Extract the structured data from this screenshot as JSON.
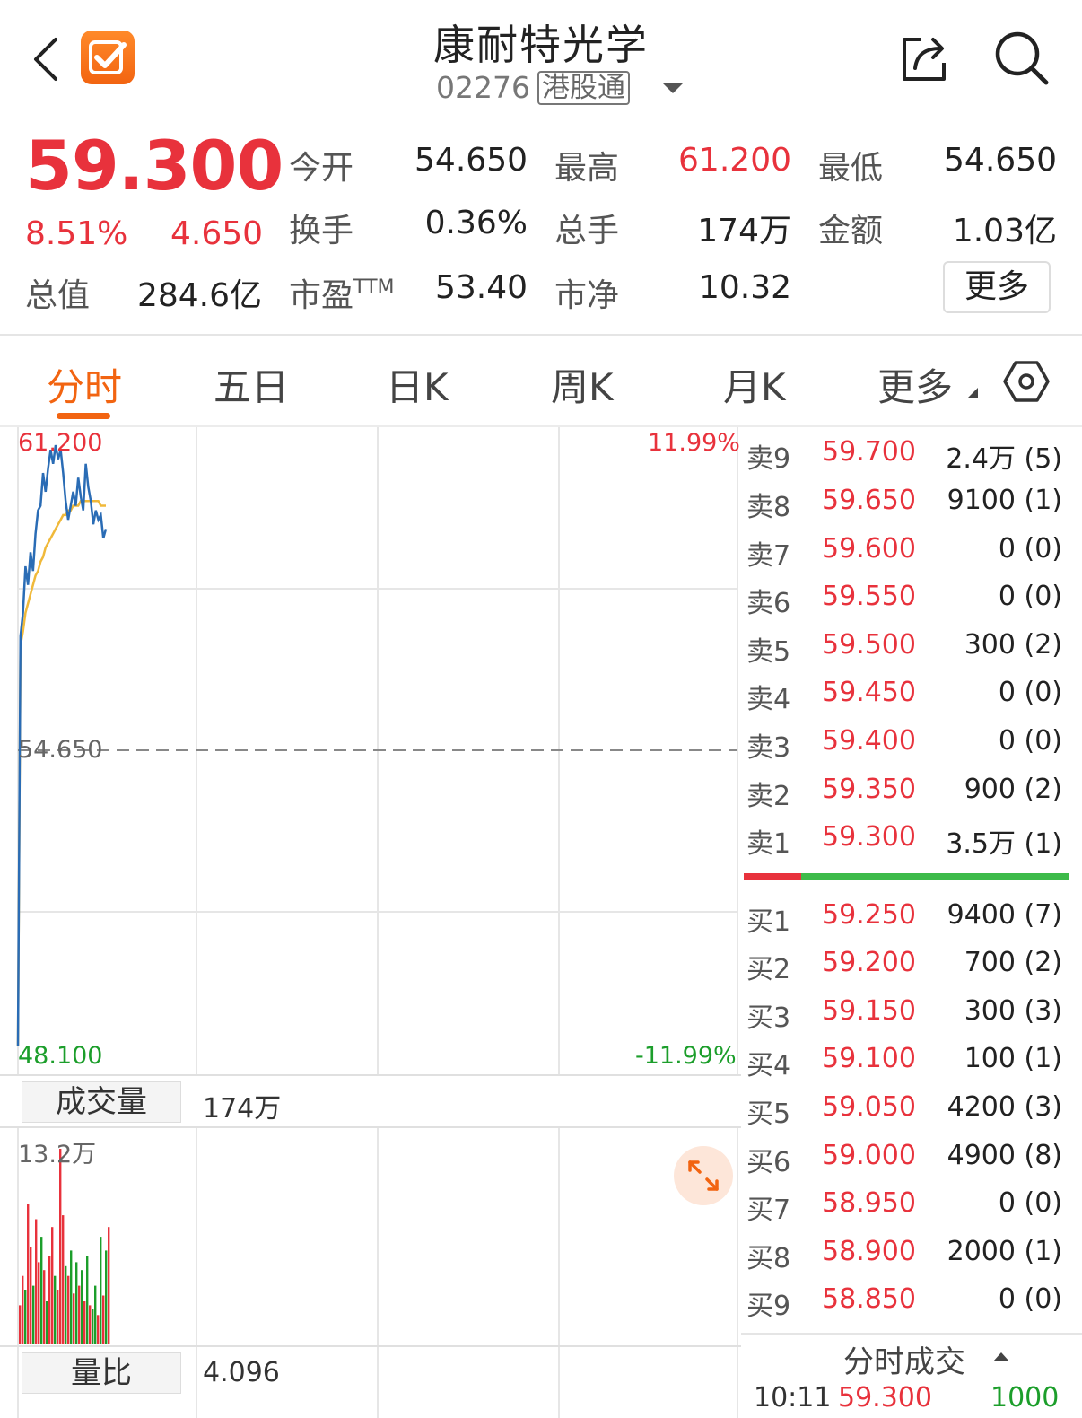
{
  "header": {
    "title": "康耐特光学",
    "code": "02276",
    "market": "港股通"
  },
  "quote": {
    "price": "59.300",
    "change_pct": "8.51%",
    "change_amt": "4.650",
    "stats": [
      {
        "label": "今开",
        "value": "54.650",
        "color": "normal"
      },
      {
        "label": "最高",
        "value": "61.200",
        "color": "red"
      },
      {
        "label": "最低",
        "value": "54.650",
        "color": "normal"
      },
      {
        "label": "换手",
        "value": "0.36%",
        "color": "normal"
      },
      {
        "label": "总手",
        "value": "174万",
        "color": "normal"
      },
      {
        "label": "金额",
        "value": "1.03亿",
        "color": "normal"
      },
      {
        "label": "总值",
        "value": "284.6亿",
        "color": "normal"
      },
      {
        "label": "市盈",
        "sup": "TTM",
        "value": "53.40",
        "color": "normal"
      },
      {
        "label": "市净",
        "value": "10.32",
        "color": "normal"
      }
    ],
    "more_label": "更多"
  },
  "tabs": [
    "分时",
    "五日",
    "日K",
    "周K",
    "月K",
    "更多"
  ],
  "active_tab": "分时",
  "chart": {
    "y_high": "61.200",
    "y_mid": "54.650",
    "y_low": "48.100",
    "pct_high": "11.99%",
    "pct_low": "-11.99%"
  },
  "chart_data": {
    "type": "line",
    "ylim": [
      48.1,
      61.2
    ],
    "prev_close": 54.65,
    "series": [
      {
        "values": [
          48.3,
          57.1,
          57.6,
          58.6,
          58.2,
          58.9,
          58.5,
          59.3,
          59.8,
          59.9,
          60.6,
          60.2,
          60.7,
          61.1,
          60.8,
          61.2,
          60.9,
          61.1,
          60.6,
          60.0,
          59.6,
          59.9,
          60.2,
          59.9,
          60.5,
          60.1,
          59.8,
          60.8,
          60.3,
          60.0,
          59.5,
          59.8,
          59.6,
          59.7,
          59.2,
          59.4
        ]
      },
      {
        "values": [
          48.3,
          56.9,
          57.2,
          57.6,
          57.8,
          58.0,
          58.2,
          58.4,
          58.5,
          58.7,
          58.8,
          59.0,
          59.1,
          59.2,
          59.3,
          59.4,
          59.5,
          59.6,
          59.7,
          59.7,
          59.8,
          59.8,
          59.9,
          59.9,
          59.9,
          60.0,
          60.0,
          60.0,
          60.0,
          60.0,
          60.0,
          60.0,
          60.0,
          59.9,
          59.9,
          59.9
        ]
      }
    ],
    "volume_max_label": "13.2万",
    "volume": [
      {
        "v": 20,
        "up": true
      },
      {
        "v": 35,
        "up": true
      },
      {
        "v": 28,
        "up": false
      },
      {
        "v": 72,
        "up": true
      },
      {
        "v": 50,
        "up": true
      },
      {
        "v": 30,
        "up": false
      },
      {
        "v": 64,
        "up": true
      },
      {
        "v": 42,
        "up": true
      },
      {
        "v": 55,
        "up": false
      },
      {
        "v": 38,
        "up": true
      },
      {
        "v": 22,
        "up": false
      },
      {
        "v": 45,
        "up": true
      },
      {
        "v": 60,
        "up": true
      },
      {
        "v": 35,
        "up": false
      },
      {
        "v": 28,
        "up": true
      },
      {
        "v": 100,
        "up": true
      },
      {
        "v": 66,
        "up": true
      },
      {
        "v": 40,
        "up": false
      },
      {
        "v": 35,
        "up": true
      },
      {
        "v": 48,
        "up": false
      },
      {
        "v": 26,
        "up": true
      },
      {
        "v": 42,
        "up": false
      },
      {
        "v": 30,
        "up": true
      },
      {
        "v": 38,
        "up": false
      },
      {
        "v": 22,
        "up": true
      },
      {
        "v": 45,
        "up": false
      },
      {
        "v": 20,
        "up": true
      },
      {
        "v": 18,
        "up": false
      },
      {
        "v": 30,
        "up": false
      },
      {
        "v": 15,
        "up": true
      },
      {
        "v": 55,
        "up": false
      },
      {
        "v": 25,
        "up": true
      },
      {
        "v": 48,
        "up": false
      },
      {
        "v": 60,
        "up": true
      }
    ]
  },
  "volume_panel": {
    "label": "成交量",
    "value": "174万"
  },
  "ratio_panel": {
    "label": "量比",
    "value": "4.096"
  },
  "order_book": {
    "asks": [
      {
        "label": "卖9",
        "price": "59.700",
        "vol": "2.4万 (5)"
      },
      {
        "label": "卖8",
        "price": "59.650",
        "vol": "9100 (1)"
      },
      {
        "label": "卖7",
        "price": "59.600",
        "vol": "0 (0)"
      },
      {
        "label": "卖6",
        "price": "59.550",
        "vol": "0 (0)"
      },
      {
        "label": "卖5",
        "price": "59.500",
        "vol": "300 (2)"
      },
      {
        "label": "卖4",
        "price": "59.450",
        "vol": "0 (0)"
      },
      {
        "label": "卖3",
        "price": "59.400",
        "vol": "0 (0)"
      },
      {
        "label": "卖2",
        "price": "59.350",
        "vol": "900 (2)"
      },
      {
        "label": "卖1",
        "price": "59.300",
        "vol": "3.5万 (1)"
      }
    ],
    "bids": [
      {
        "label": "买1",
        "price": "59.250",
        "vol": "9400 (7)"
      },
      {
        "label": "买2",
        "price": "59.200",
        "vol": "700 (2)"
      },
      {
        "label": "买3",
        "price": "59.150",
        "vol": "300 (3)"
      },
      {
        "label": "买4",
        "price": "59.100",
        "vol": "100 (1)"
      },
      {
        "label": "买5",
        "price": "59.050",
        "vol": "4200 (3)"
      },
      {
        "label": "买6",
        "price": "59.000",
        "vol": "4900 (8)"
      },
      {
        "label": "买7",
        "price": "58.950",
        "vol": "0 (0)"
      },
      {
        "label": "买8",
        "price": "58.900",
        "vol": "2000 (1)"
      },
      {
        "label": "买9",
        "price": "58.850",
        "vol": "0 (0)"
      }
    ]
  },
  "ticks": {
    "header": "分时成交",
    "rows": [
      {
        "time": "10:11",
        "price": "59.300",
        "vol": "1000"
      }
    ]
  },
  "colors": {
    "up": "#e8323c",
    "down": "#1c9e2b",
    "accent": "#f26411",
    "price_line": "#2a6cb5",
    "avg_line": "#f0b93a"
  }
}
